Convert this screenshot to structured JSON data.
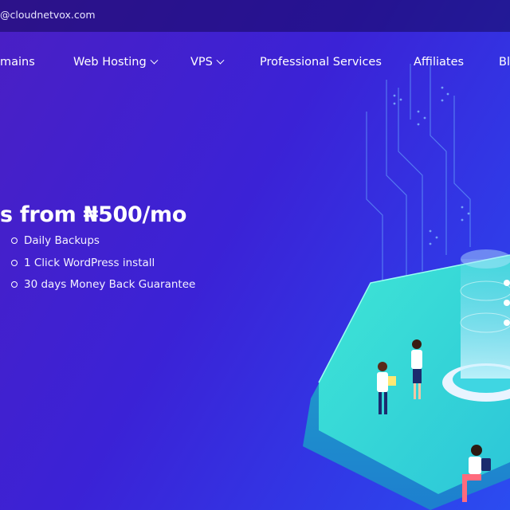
{
  "topbar": {
    "email": "@cloudnetvox.com"
  },
  "nav": {
    "items": [
      {
        "label": "mains",
        "has_dropdown": false
      },
      {
        "label": "Web Hosting",
        "has_dropdown": true
      },
      {
        "label": "VPS",
        "has_dropdown": true
      },
      {
        "label": "Professional Services",
        "has_dropdown": false
      },
      {
        "label": "Affiliates",
        "has_dropdown": false
      },
      {
        "label": "Bl",
        "has_dropdown": false
      }
    ]
  },
  "hero": {
    "title": "s from ₦500/mo",
    "features": [
      "Daily Backups",
      "1 Click WordPress install",
      "30 days Money Back Guarantee"
    ]
  },
  "colors": {
    "background_start": "#4a1fc4",
    "background_end": "#2b4cf0",
    "accent_teal": "#3fe6d6",
    "text": "#ffffff"
  }
}
